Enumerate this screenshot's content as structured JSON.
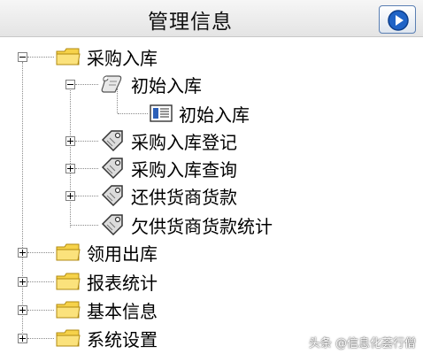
{
  "header": {
    "title": "管理信息",
    "play_icon": "play-circle-icon"
  },
  "tree": {
    "root_1": {
      "label": "采购入库",
      "children": {
        "initial": {
          "label": "初始入库",
          "children": {
            "initial_form": {
              "label": "初始入库"
            }
          }
        },
        "register": {
          "label": "采购入库登记"
        },
        "query": {
          "label": "采购入库查询"
        },
        "repay": {
          "label": "还供货商货款"
        },
        "owed_stats": {
          "label": "欠供货商货款统计"
        }
      }
    },
    "root_2": {
      "label": "领用出库"
    },
    "root_3": {
      "label": "报表统计"
    },
    "root_4": {
      "label": "基本信息"
    },
    "root_5": {
      "label": "系统设置"
    }
  },
  "watermark": "头条 @信息化荟行僧",
  "colors": {
    "folder": "#f6d24a",
    "folder_edge": "#b08a10",
    "nav_button": "#1f63c6"
  }
}
